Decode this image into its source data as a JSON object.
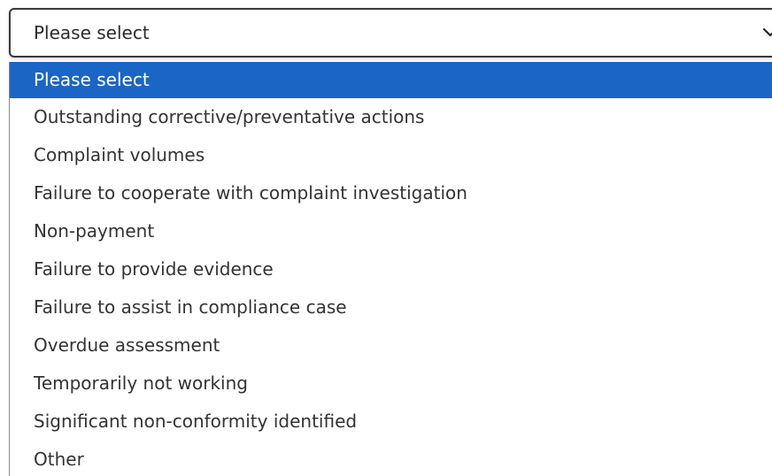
{
  "select": {
    "value": "Please select",
    "icon": "chevron-down-icon"
  },
  "options": [
    {
      "label": "Please select",
      "selected": true
    },
    {
      "label": "Outstanding corrective/preventative actions",
      "selected": false
    },
    {
      "label": "Complaint volumes",
      "selected": false
    },
    {
      "label": "Failure to cooperate with complaint investigation",
      "selected": false
    },
    {
      "label": "Non-payment",
      "selected": false
    },
    {
      "label": "Failure to provide evidence",
      "selected": false
    },
    {
      "label": "Failure to assist in compliance case",
      "selected": false
    },
    {
      "label": "Overdue assessment",
      "selected": false
    },
    {
      "label": "Temporarily not working",
      "selected": false
    },
    {
      "label": "Significant non-conformity identified",
      "selected": false
    },
    {
      "label": "Other",
      "selected": false
    }
  ],
  "colors": {
    "highlight": "#1b65c4",
    "text": "#333333",
    "border": "#3a3a3a"
  }
}
